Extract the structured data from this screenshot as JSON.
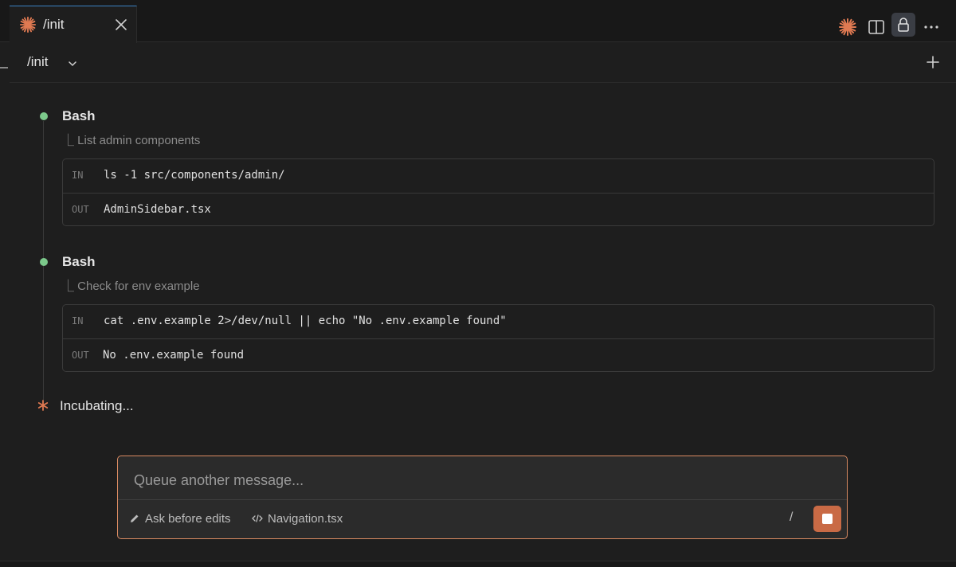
{
  "tab": {
    "title": "/init",
    "icon": "claude-spark-icon",
    "close_icon": "close-icon"
  },
  "toolbar": {
    "icons": [
      "claude-spark-icon",
      "split-editor-icon",
      "lock-icon",
      "more-icon"
    ]
  },
  "header": {
    "session_title": "/init",
    "chevron_icon": "chevron-down-icon",
    "new_icon": "plus-icon"
  },
  "tool_calls": [
    {
      "name": "Bash",
      "description": "⎿ List admin components",
      "in_label": "IN",
      "in_text": "ls -1 src/components/admin/",
      "out_label": "OUT",
      "out_text": "AdminSidebar.tsx"
    },
    {
      "name": "Bash",
      "description": "⎿ Check for env example",
      "in_label": "IN",
      "in_text": "cat .env.example 2>/dev/null || echo \"No .env.example found\"",
      "out_label": "OUT",
      "out_text": "No .env.example found"
    }
  ],
  "status": {
    "text": "Incubating...",
    "icon": "asterisk-icon"
  },
  "composer": {
    "placeholder": "Queue another message...",
    "mode_label": "Ask before edits",
    "mode_icon": "pencil-icon",
    "file_label": "Navigation.tsx",
    "file_icon": "code-icon",
    "slash_label": "/",
    "stop_icon": "stop-icon"
  },
  "colors": {
    "accent": "#d98a62",
    "success_dot": "#7cc98b",
    "stop_button": "#c96a45",
    "tab_accent": "#3b82c4"
  }
}
